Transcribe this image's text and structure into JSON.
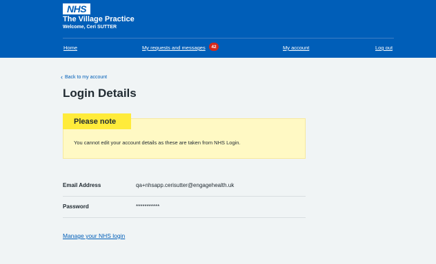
{
  "header": {
    "logo": "NHS",
    "practice_name": "The Village Practice",
    "welcome": "Welcome, Ceri SUTTER"
  },
  "nav": {
    "home": "Home",
    "requests": "My requests and messages",
    "requests_badge": "42",
    "account": "My account",
    "logout": "Log out"
  },
  "back_link": "Back to my account",
  "page_title": "Login Details",
  "notice": {
    "title": "Please note",
    "text": "You cannot edit your account details as these are taken from NHS Login."
  },
  "details": [
    {
      "label": "Email Address",
      "value": "qa+nhsapp.cerisutter@engagehealth.uk"
    },
    {
      "label": "Password",
      "value": "***********"
    }
  ],
  "manage_link": "Manage your NHS login",
  "colors": {
    "nhs_blue": "#005eb8",
    "badge_red": "#d5281b",
    "note_yellow": "#ffeb3b",
    "note_bg": "#fff9c4",
    "page_bg": "#f0f4f5"
  }
}
